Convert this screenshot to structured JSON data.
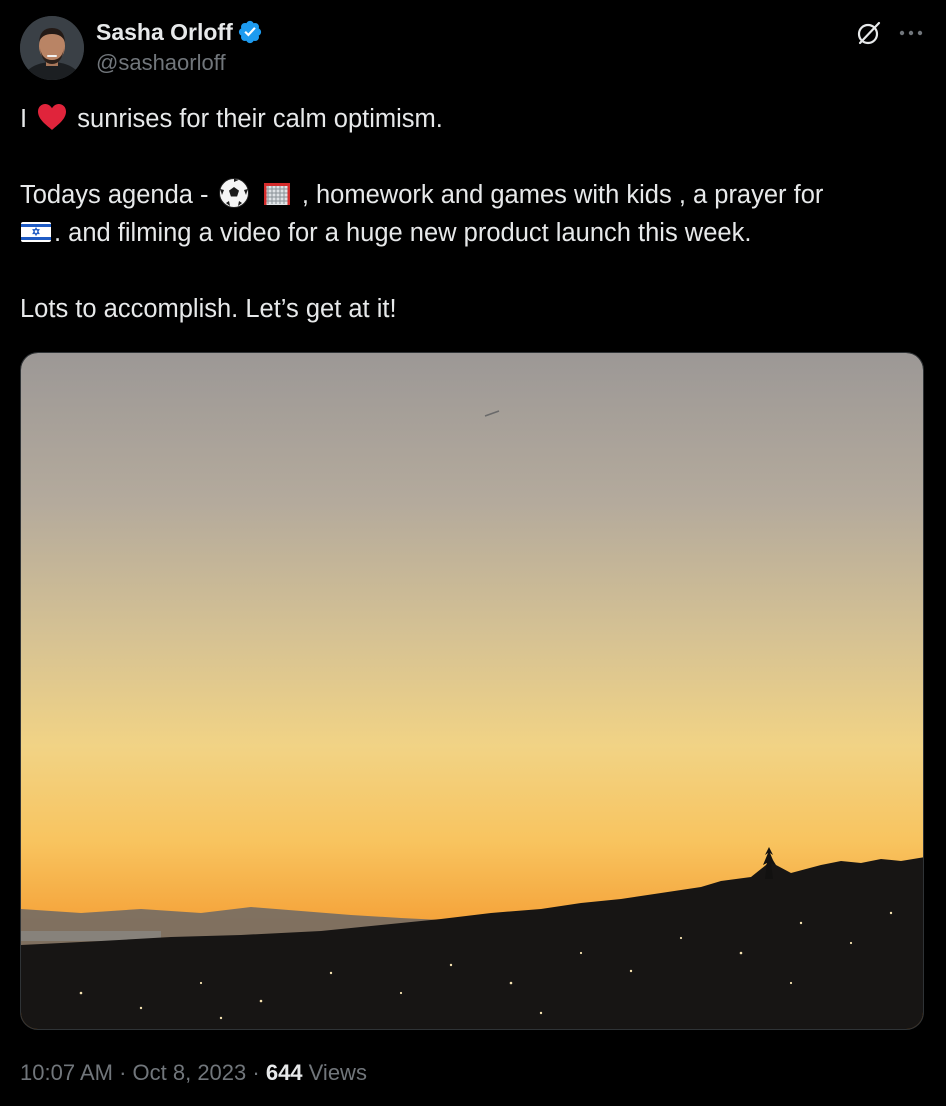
{
  "author": {
    "display_name": "Sasha Orloff",
    "handle": "@sashaorloff",
    "verified_icon": "verified-badge-icon",
    "accent_color": "#1d9bf0"
  },
  "actions": {
    "grok_icon": "grok-icon",
    "more_icon": "more-icon"
  },
  "tweet": {
    "line1_start": "I",
    "line1_emoji": "heart-emoji",
    "line1_end": " sunrises for their calm optimism.",
    "line2_start": "Todays agenda - ",
    "line2_emoji_1": "soccer-ball-emoji",
    "line2_emoji_2": "goal-net-emoji",
    "line2_end": ", homework and games with kids , a prayer for",
    "line3_emoji": "israel-flag-emoji",
    "line3_end": ". and filming a video for a huge new product launch this week.",
    "line4": "Lots to accomplish. Let’s get at it!"
  },
  "media": {
    "type": "photo",
    "subject": "sunset-city-skyline"
  },
  "meta": {
    "time": "10:07 AM",
    "separator1": " · ",
    "date": "Oct 8, 2023",
    "separator2": " · ",
    "views_count": "644",
    "views_label": " Views"
  },
  "colors": {
    "background": "#000000",
    "text_primary": "#e7e9ea",
    "text_secondary": "#71767b",
    "border": "#2f3336"
  }
}
